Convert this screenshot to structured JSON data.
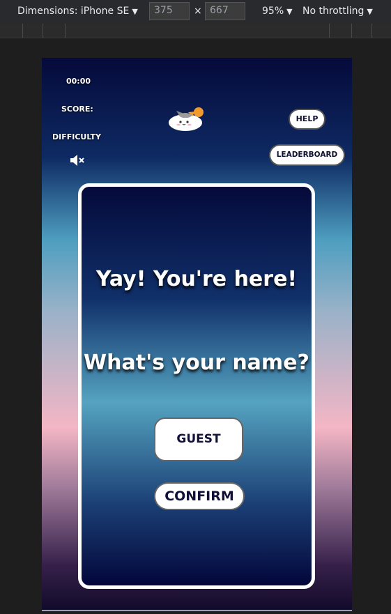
{
  "devtools": {
    "dimensions_label": "Dimensions: iPhone SE",
    "width": "375",
    "height": "667",
    "times": "×",
    "zoom": "95%",
    "throttling": "No throttling"
  },
  "hud": {
    "timer": "00:00",
    "score_label": "SCORE:",
    "difficulty_label": "DIFFICULTY",
    "help_label": "HELP",
    "leaderboard_label": "LEADERBOARD"
  },
  "modal": {
    "greeting": "Yay! You're here!",
    "question": "What's your name?",
    "name_input_value": "GUEST",
    "confirm_label": "CONFIRM"
  },
  "icons": {
    "sound": "muted-speaker-icon",
    "mascot": "cat-mascot-icon",
    "dropdown": "caret-down-icon"
  },
  "colors": {
    "button_text": "#101038",
    "modal_border": "#ffffff"
  }
}
